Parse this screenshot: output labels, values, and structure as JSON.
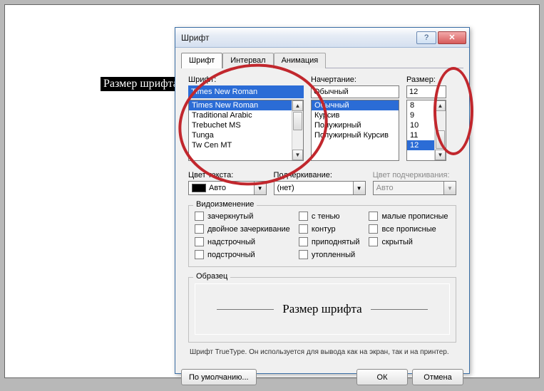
{
  "page": {
    "selection_text": "Размер шрифта"
  },
  "dialog": {
    "title": "Шрифт",
    "help": "?",
    "close": "✕",
    "tabs": [
      "Шрифт",
      "Интервал",
      "Анимация"
    ],
    "active_tab": 0,
    "font": {
      "label": "Шрифт:",
      "value": "Times New Roman",
      "list": [
        "Times New Roman",
        "Traditional Arabic",
        "Trebuchet MS",
        "Tunga",
        "Tw Cen MT"
      ],
      "selected_index": 0
    },
    "style": {
      "label": "Начертание:",
      "value": "Обычный",
      "list": [
        "Обычный",
        "Курсив",
        "Полужирный",
        "Полужирный Курсив"
      ],
      "selected_index": 0
    },
    "size": {
      "label": "Размер:",
      "value": "12",
      "list": [
        "8",
        "9",
        "10",
        "11",
        "12"
      ],
      "selected_index": 4
    },
    "color": {
      "label": "Цвет текста:",
      "value": "Авто"
    },
    "underline": {
      "label": "Подчеркивание:",
      "value": "(нет)"
    },
    "ucolor": {
      "label": "Цвет подчеркивания:",
      "value": "Авто"
    },
    "effects": {
      "legend": "Видоизменение",
      "col1": [
        "зачеркнутый",
        "двойное зачеркивание",
        "надстрочный",
        "подстрочный"
      ],
      "col2": [
        "с тенью",
        "контур",
        "приподнятый",
        "утопленный"
      ],
      "col3": [
        "малые прописные",
        "все прописные",
        "скрытый"
      ]
    },
    "sample": {
      "legend": "Образец",
      "text": "Размер шрифта"
    },
    "note": "Шрифт TrueType. Он используется для вывода как на экран, так и на принтер.",
    "buttons": {
      "default": "По умолчанию...",
      "ok": "ОК",
      "cancel": "Отмена"
    }
  }
}
